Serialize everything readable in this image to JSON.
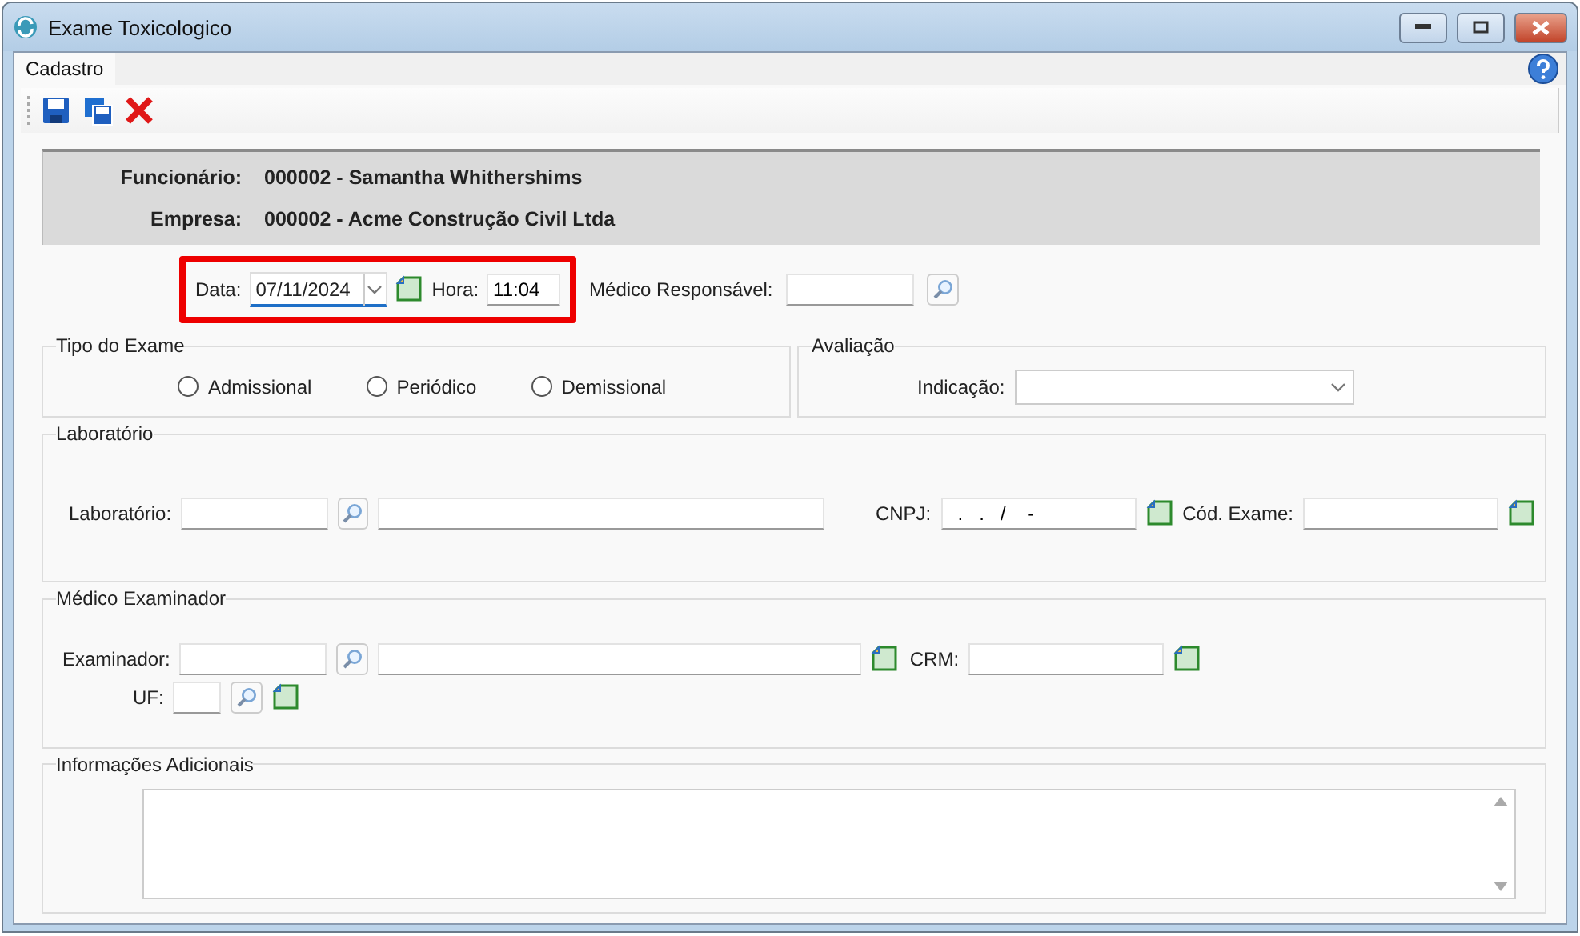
{
  "window": {
    "title": "Exame Toxicologico"
  },
  "tabs": [
    {
      "label": "Cadastro",
      "selected": true
    }
  ],
  "header": [
    {
      "label": "Funcionário:",
      "value": "000002 - Samantha Whithershims"
    },
    {
      "label": "Empresa:",
      "value": "000002 - Acme Construção Civil Ltda"
    }
  ],
  "date_row": {
    "date_label": "Data:",
    "date": "07/11/2024",
    "time_label": "Hora:",
    "time": "11:04",
    "doctor_label": "Médico Responsável:"
  },
  "exam_type": {
    "title": "Tipo do Exame",
    "options": [
      {
        "label": "Admissional",
        "selected": false
      },
      {
        "label": "Periódico",
        "selected": false
      },
      {
        "label": "Demissional",
        "selected": false
      }
    ]
  },
  "evaluation": {
    "title": "Avaliação",
    "label": "Indicação:"
  },
  "laboratory": {
    "title": "Laboratório",
    "label": "Laboratório:",
    "cnpj_label": "CNPJ:",
    "cnpj_value": "  .   .   /    -",
    "code_label": "Cód. Exame:"
  },
  "examiner": {
    "title": "Médico Examinador",
    "label": "Examinador:",
    "crm_label": "CRM:",
    "uf_label": "UF:"
  },
  "notes": {
    "title": "Informações Adicionais"
  }
}
